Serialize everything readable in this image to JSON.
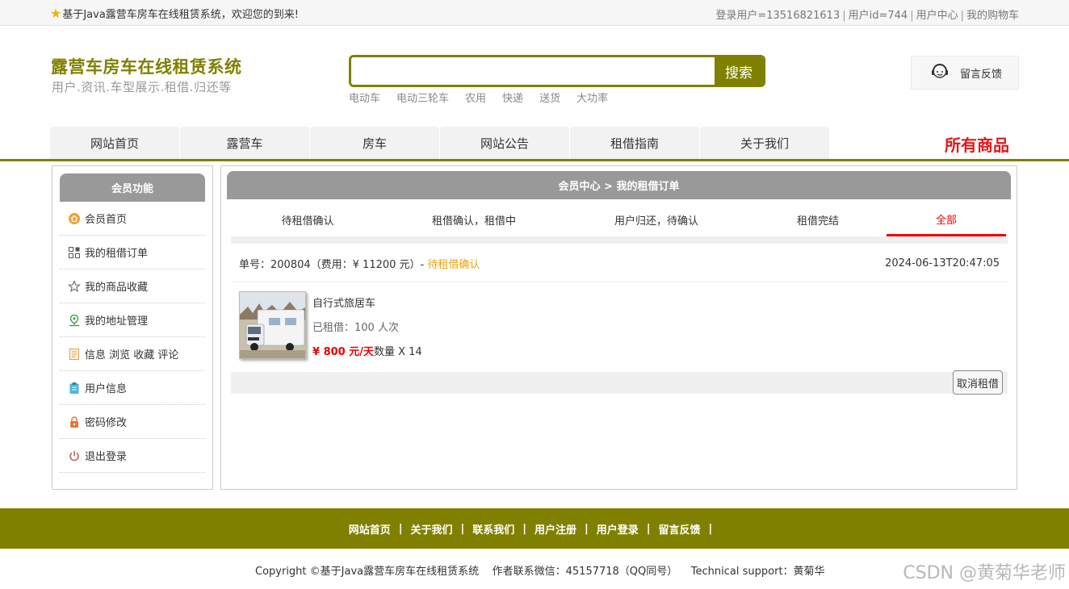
{
  "topbar": {
    "welcome": "基于Java露营车房车在线租赁系统，欢迎您的到来!",
    "login_user": "登录用户=13516821613",
    "user_id": "用户id=744",
    "user_center": "用户中心",
    "cart": "我的购物车"
  },
  "header": {
    "title": "露营车房车在线租赁系统",
    "subtitle": "用户.资讯.车型展示.租借.归还等",
    "search_placeholder": "",
    "search_button": "搜索",
    "hot_keywords": [
      "电动车",
      "电动三轮车",
      "农用",
      "快递",
      "送货",
      "大功率"
    ],
    "feedback": "留言反馈"
  },
  "nav": {
    "items": [
      "网站首页",
      "露营车",
      "房车",
      "网站公告",
      "租借指南",
      "关于我们"
    ],
    "all_goods": "所有商品"
  },
  "sidebar": {
    "title": "会员功能",
    "items": [
      {
        "label": "会员首页",
        "icon": "home-icon"
      },
      {
        "label": "我的租借订单",
        "icon": "grid-icon"
      },
      {
        "label": "我的商品收藏",
        "icon": "star-icon"
      },
      {
        "label": "我的地址管理",
        "icon": "map-pin-icon"
      },
      {
        "label": "信息 浏览 收藏 评论",
        "icon": "document-icon"
      },
      {
        "label": "用户信息",
        "icon": "clipboard-icon"
      },
      {
        "label": "密码修改",
        "icon": "lock-icon"
      },
      {
        "label": "退出登录",
        "icon": "power-icon"
      }
    ]
  },
  "main": {
    "breadcrumb": "会员中心 > 我的租借订单",
    "tabs": [
      "待租借确认",
      "租借确认，租借中",
      "用户归还，待确认",
      "租借完结",
      "全部"
    ],
    "active_tab": 4,
    "order": {
      "number_label": "单号：200804",
      "fee_label": "（费用：¥ 11200 元）-",
      "status": "待租借确认",
      "time": "2024-06-13T20:47:05",
      "item_name": "自行式旅居车",
      "rented": "已租借：100 人次",
      "price": "¥ 800 元/天",
      "quantity": "数量 X 14",
      "cancel_button": "取消租借"
    }
  },
  "footer": {
    "links": [
      "网站首页",
      "关于我们",
      "联系我们",
      "用户注册",
      "用户登录",
      "留言反馈"
    ],
    "copyright": "Copyright ©基于Java露营车房车在线租赁系统    作者联系微信：45157718（QQ同号）    Technical support：黄菊华",
    "watermark": "CSDN @黄菊华老师"
  },
  "colors": {
    "brand": "#808000",
    "accent_red": "#e01818",
    "status_orange": "#e8a30f"
  }
}
